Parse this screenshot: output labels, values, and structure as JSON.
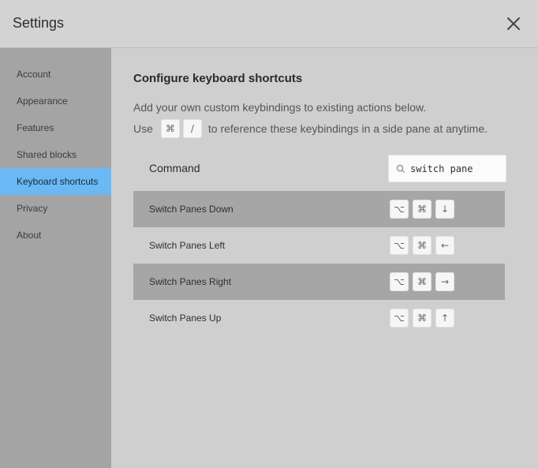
{
  "window": {
    "title": "Settings"
  },
  "sidebar": {
    "items": [
      {
        "label": "Account"
      },
      {
        "label": "Appearance"
      },
      {
        "label": "Features"
      },
      {
        "label": "Shared blocks"
      },
      {
        "label": "Keyboard shortcuts",
        "active": true
      },
      {
        "label": "Privacy"
      },
      {
        "label": "About"
      }
    ]
  },
  "main": {
    "heading": "Configure keyboard shortcuts",
    "description": "Add your own custom keybindings to existing actions below.",
    "use_label": "Use",
    "use_keys": [
      "⌘",
      "/"
    ],
    "use_suffix": "to reference these keybindings in a side pane at anytime.",
    "command_label": "Command",
    "search": {
      "value": "switch pane",
      "icon": "search-icon"
    },
    "commands": [
      {
        "name": "Switch Panes Down",
        "keys": [
          "⌥",
          "⌘",
          "↓"
        ]
      },
      {
        "name": "Switch Panes Left",
        "keys": [
          "⌥",
          "⌘",
          "←"
        ]
      },
      {
        "name": "Switch Panes Right",
        "keys": [
          "⌥",
          "⌘",
          "→"
        ]
      },
      {
        "name": "Switch Panes Up",
        "keys": [
          "⌥",
          "⌘",
          "↑"
        ]
      }
    ]
  },
  "colors": {
    "active_sidebar": "#6ab9f5",
    "sidebar_bg": "#a4a4a4",
    "shaded_row": "#a6a6a6"
  }
}
